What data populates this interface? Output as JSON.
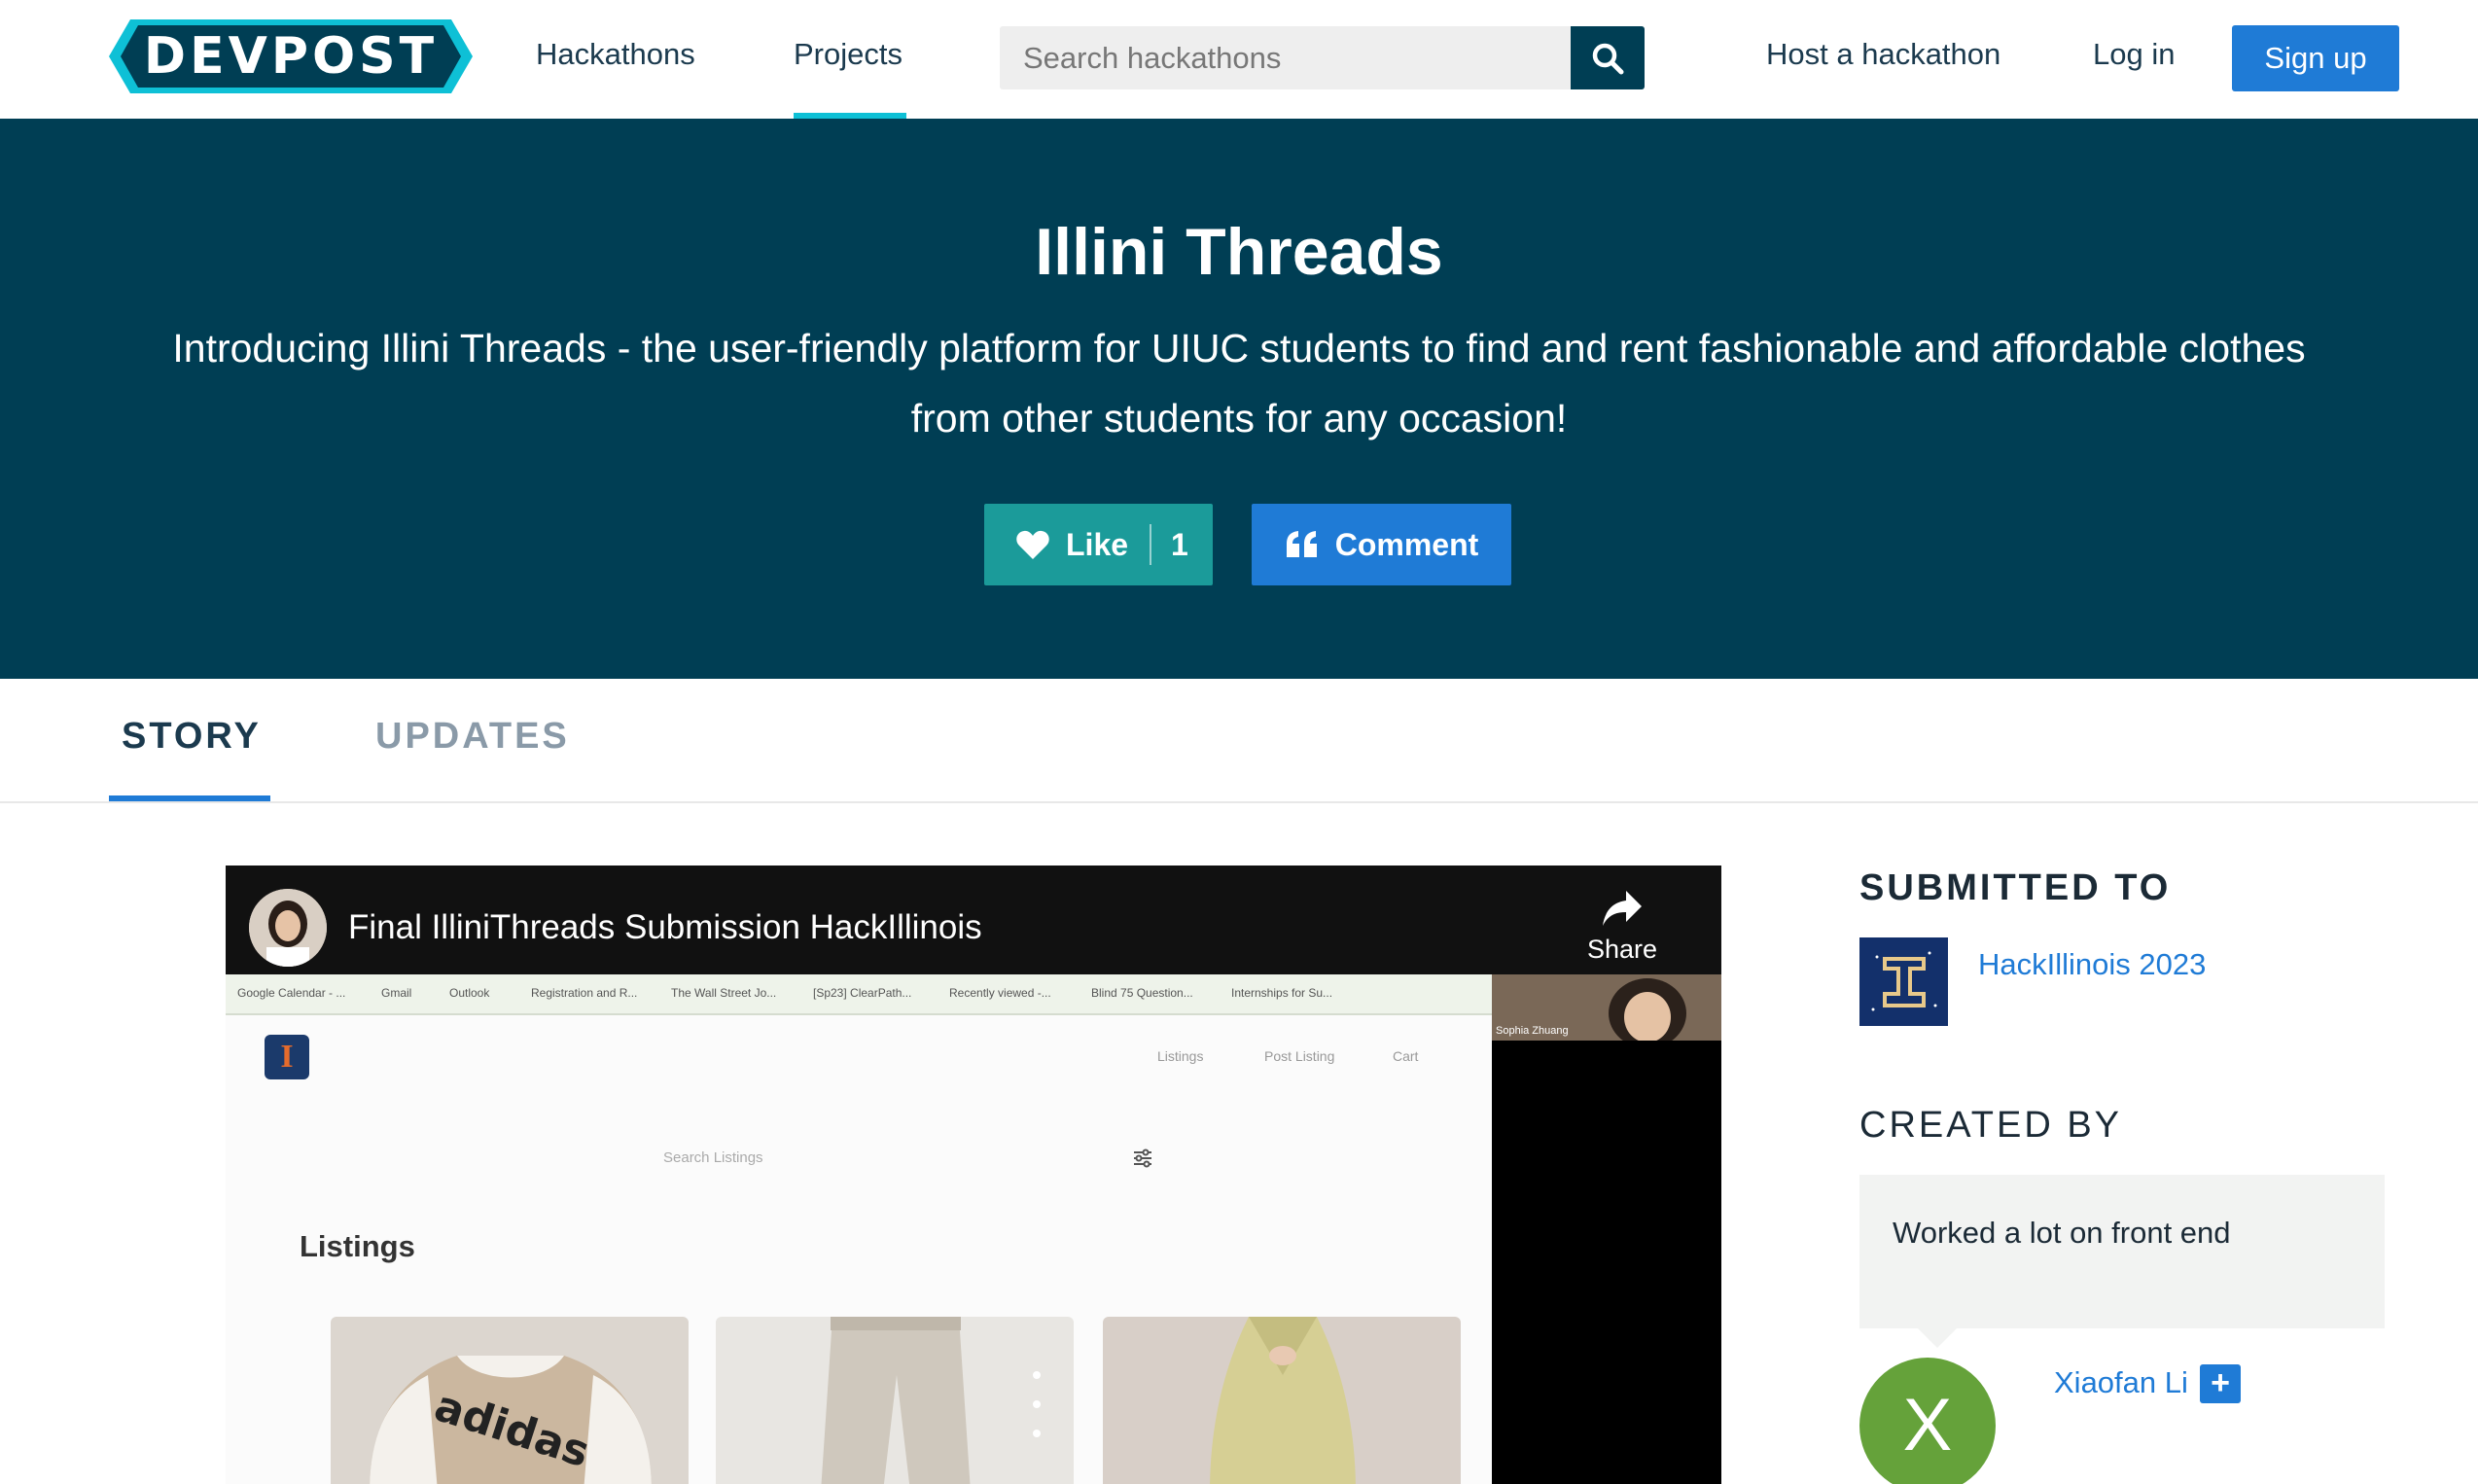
{
  "nav": {
    "logo_text": "DEVPOST",
    "links": [
      "Hackathons",
      "Projects"
    ],
    "active_link": "Projects",
    "search_placeholder": "Search hackathons",
    "host_link": "Host a hackathon",
    "login_link": "Log in",
    "signup_label": "Sign up"
  },
  "hero": {
    "title": "Illini Threads",
    "tagline": "Introducing Illini Threads - the user-friendly platform for UIUC students to find and rent fashionable and affordable clothes from other students for any occasion!",
    "like_label": "Like",
    "like_count": "1",
    "comment_label": "Comment"
  },
  "tabs": [
    {
      "label": "STORY",
      "active": true
    },
    {
      "label": "UPDATES",
      "active": false
    }
  ],
  "video": {
    "title": "Final IlliniThreads Submission HackIllinois",
    "share_label": "Share",
    "bookmarks": [
      "Google Calendar - ...",
      "Gmail",
      "Outlook",
      "Registration and R...",
      "The Wall Street Jo...",
      "[Sp23] ClearPath...",
      "Recently viewed -...",
      "Blind 75 Question...",
      "Internships for Su..."
    ],
    "app_logo_letter": "I",
    "app_nav": [
      "Listings",
      "Post Listing",
      "Cart"
    ],
    "app_search_placeholder": "Search Listings",
    "listings_heading": "Listings",
    "participant_name": "Sophia Zhuang"
  },
  "sidebar": {
    "submitted_heading": "SUBMITTED TO",
    "hackathon_name": "HackIllinois 2023",
    "created_heading": "CREATED BY",
    "member_note": "Worked a lot on front end",
    "member_initial": "X",
    "member_name": "Xiaofan Li",
    "follow_symbol": "+"
  },
  "colors": {
    "brand_dark": "#003e54",
    "accent_cyan": "#0ec0d6",
    "primary_blue": "#1f7bd6",
    "like_teal": "#1b9b9a",
    "avatar_green": "#65a23a"
  }
}
